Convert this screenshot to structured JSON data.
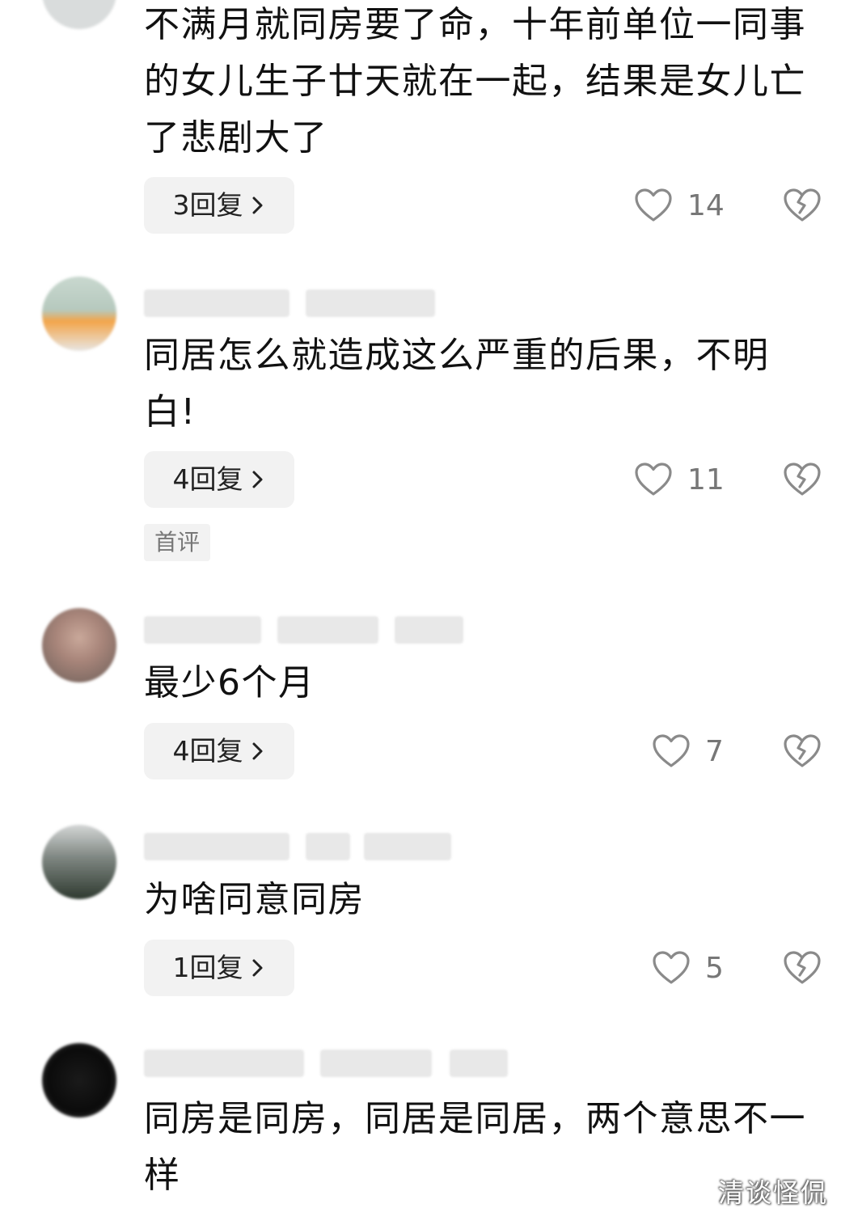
{
  "comments": [
    {
      "text": "不满月就同房要了命，十年前单位一同事的女儿生子廿天就在一起，结果是女儿亡了悲剧大了",
      "reply_label": "3回复",
      "like_count": "14"
    },
    {
      "text": "同居怎么就造成这么严重的后果，不明白!",
      "reply_label": "4回复",
      "like_count": "11",
      "badge": "首评"
    },
    {
      "text": "最少6个月",
      "reply_label": "4回复",
      "like_count": "7"
    },
    {
      "text": "为啥同意同房",
      "reply_label": "1回复",
      "like_count": "5"
    },
    {
      "text": "同房是同房，同居是同居，两个意思不一样"
    }
  ],
  "watermark": "清谈怪侃",
  "icons": {
    "like": "heart-outline-icon",
    "dislike": "broken-heart-icon",
    "reply_arrow": "chevron-right-icon"
  },
  "colors": {
    "text": "#111111",
    "muted": "#777777",
    "chip_bg": "#f2f2f2",
    "icon": "#8a8a8a"
  }
}
